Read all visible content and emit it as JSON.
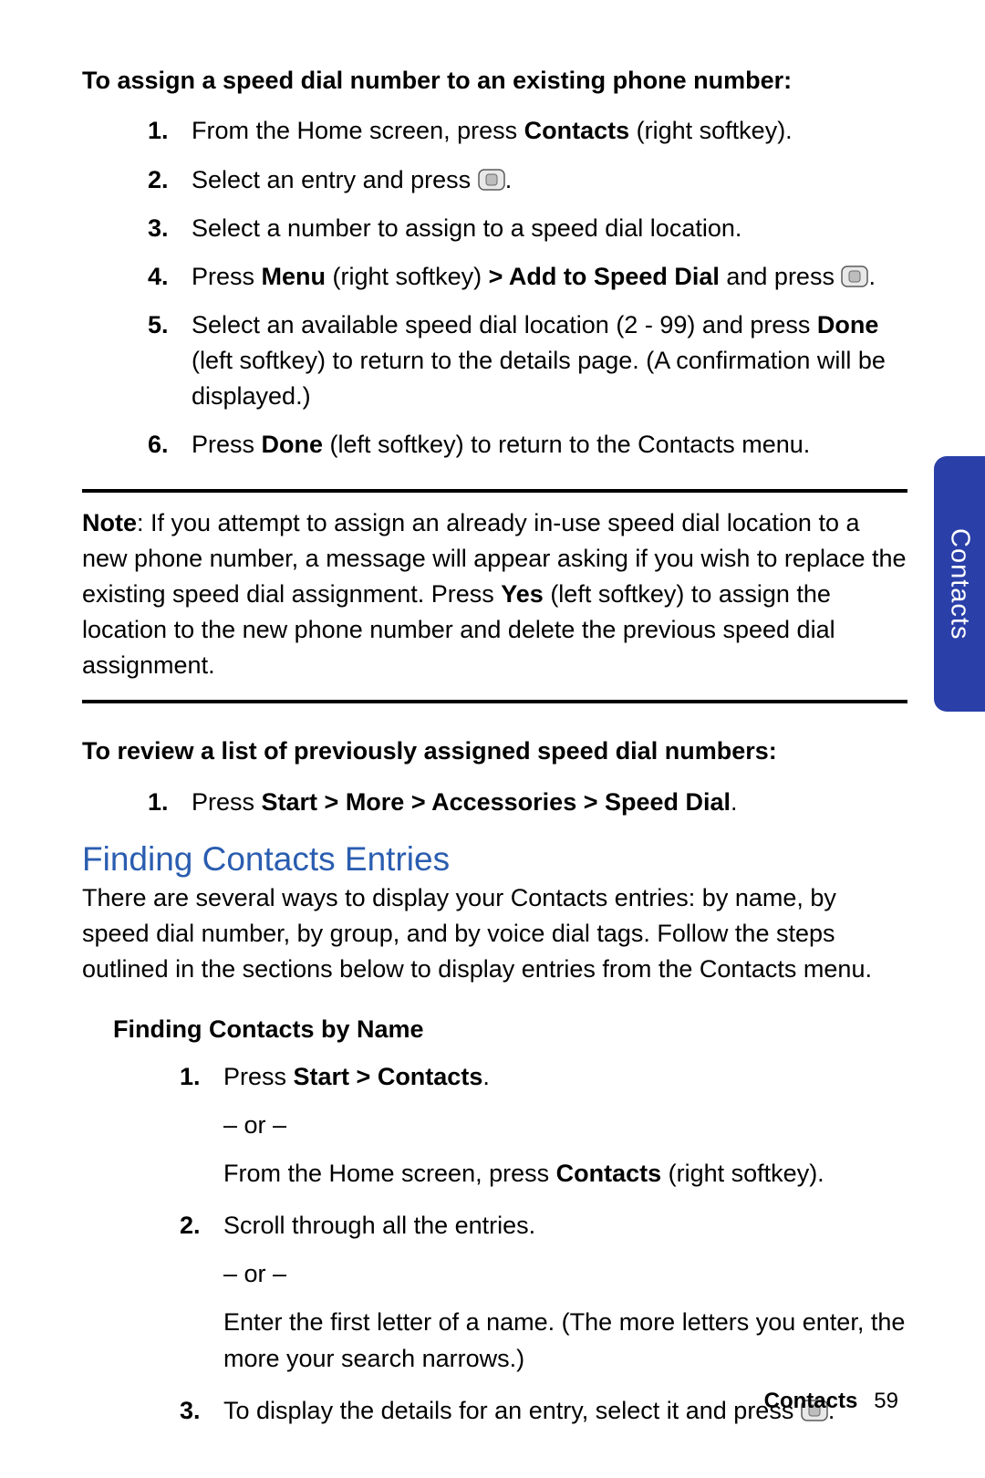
{
  "sideTab": "Contacts",
  "footer": {
    "section": "Contacts",
    "page": "59"
  },
  "lead1": "To assign a speed dial number to an existing phone number:",
  "s1": {
    "n1": "1.",
    "t1a": "From the Home screen, press ",
    "t1b": "Contacts",
    "t1c": " (right softkey).",
    "n2": "2.",
    "t2a": "Select an entry and press ",
    "t2b": ".",
    "n3": "3.",
    "t3": "Select a number to assign to a speed dial location.",
    "n4": "4.",
    "t4a": "Press ",
    "t4b": "Menu",
    "t4c": " (right softkey) ",
    "t4d": "> Add to Speed Dial",
    "t4e": " and press ",
    "t4f": ".",
    "n5": "5.",
    "t5a": "Select an available speed dial location (2 - 99) and press ",
    "t5b": "Done",
    "t5c": " (left softkey) to return to the details page. (A confirmation will be displayed.)",
    "n6": "6.",
    "t6a": "Press ",
    "t6b": "Done",
    "t6c": " (left softkey) to return to the Contacts menu."
  },
  "note": {
    "a": "Note",
    "b": ": If you attempt to assign an already in-use speed dial location to a new phone number, a message will appear asking if you wish to replace the existing speed dial assignment. Press ",
    "c": "Yes",
    "d": " (left softkey) to assign the location to the new phone number and delete the previous speed dial assignment."
  },
  "lead2": "To review a list of previously assigned speed dial numbers:",
  "s2": {
    "n1": "1.",
    "t1a": "Press ",
    "t1b": "Start > More > Accessories > Speed Dial",
    "t1c": "."
  },
  "sectionTitle": "Finding Contacts Entries",
  "sectionBody": "There are several ways to display your Contacts entries: by name, by speed dial number, by group, and by voice dial tags. Follow the steps outlined in the sections below to display entries from the Contacts menu.",
  "lead3": "Finding Contacts by Name",
  "s3": {
    "n1": "1.",
    "t1a": "Press ",
    "t1b": "Start > Contacts",
    "t1c": ".",
    "or": "– or –",
    "t1d": "From the Home screen, press ",
    "t1e": "Contacts",
    "t1f": " (right softkey).",
    "n2": "2.",
    "t2": "Scroll through all the entries.",
    "t2b": "Enter the first letter of a name. (The more letters you enter, the more your search narrows.)",
    "n3": "3.",
    "t3a": "To display the details for an entry, select it and press ",
    "t3b": "."
  }
}
